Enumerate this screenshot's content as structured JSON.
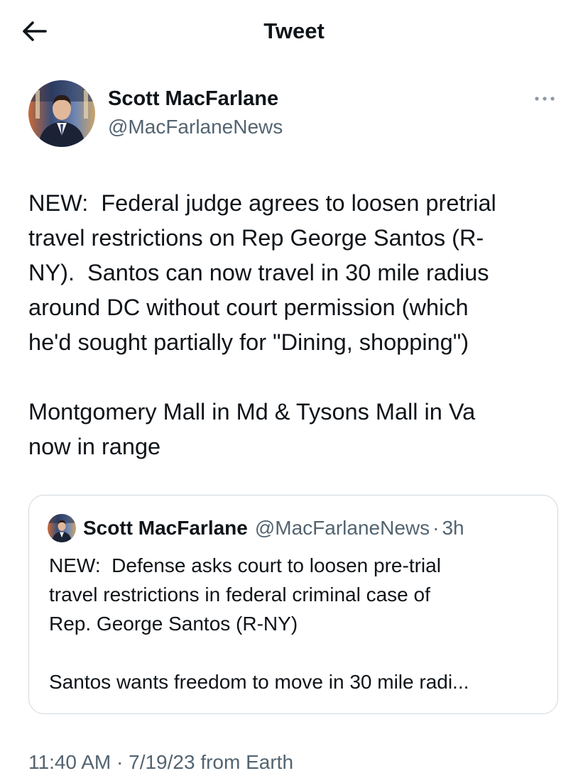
{
  "header": {
    "title": "Tweet",
    "back_icon": "arrow-left-icon"
  },
  "tweet": {
    "author": {
      "name": "Scott MacFarlane",
      "handle": "@MacFarlaneNews"
    },
    "more_icon": "more-horizontal-icon",
    "text": "NEW:  Federal judge agrees to loosen pretrial\ntravel restrictions on Rep George Santos (R-\nNY).  Santos can now travel in 30 mile radius\naround DC without court permission (which\nhe'd sought partially for \"Dining, shopping\")\n\nMontgomery Mall in Md & Tysons Mall in Va\nnow in range",
    "quoted": {
      "name": "Scott MacFarlane",
      "handle": "@MacFarlaneNews",
      "separator": "·",
      "time": "3h",
      "text": "NEW:  Defense asks court to loosen pre-trial\ntravel restrictions in federal criminal case of\nRep. George Santos (R-NY)\n\nSantos wants freedom to move in 30 mile radi..."
    },
    "meta": {
      "time": "11:40 AM",
      "separator": " · ",
      "date": "7/19/23",
      "source": " from Earth"
    }
  },
  "colors": {
    "text_primary": "#0f1419",
    "text_secondary": "#536471",
    "border": "#cfd9de"
  }
}
